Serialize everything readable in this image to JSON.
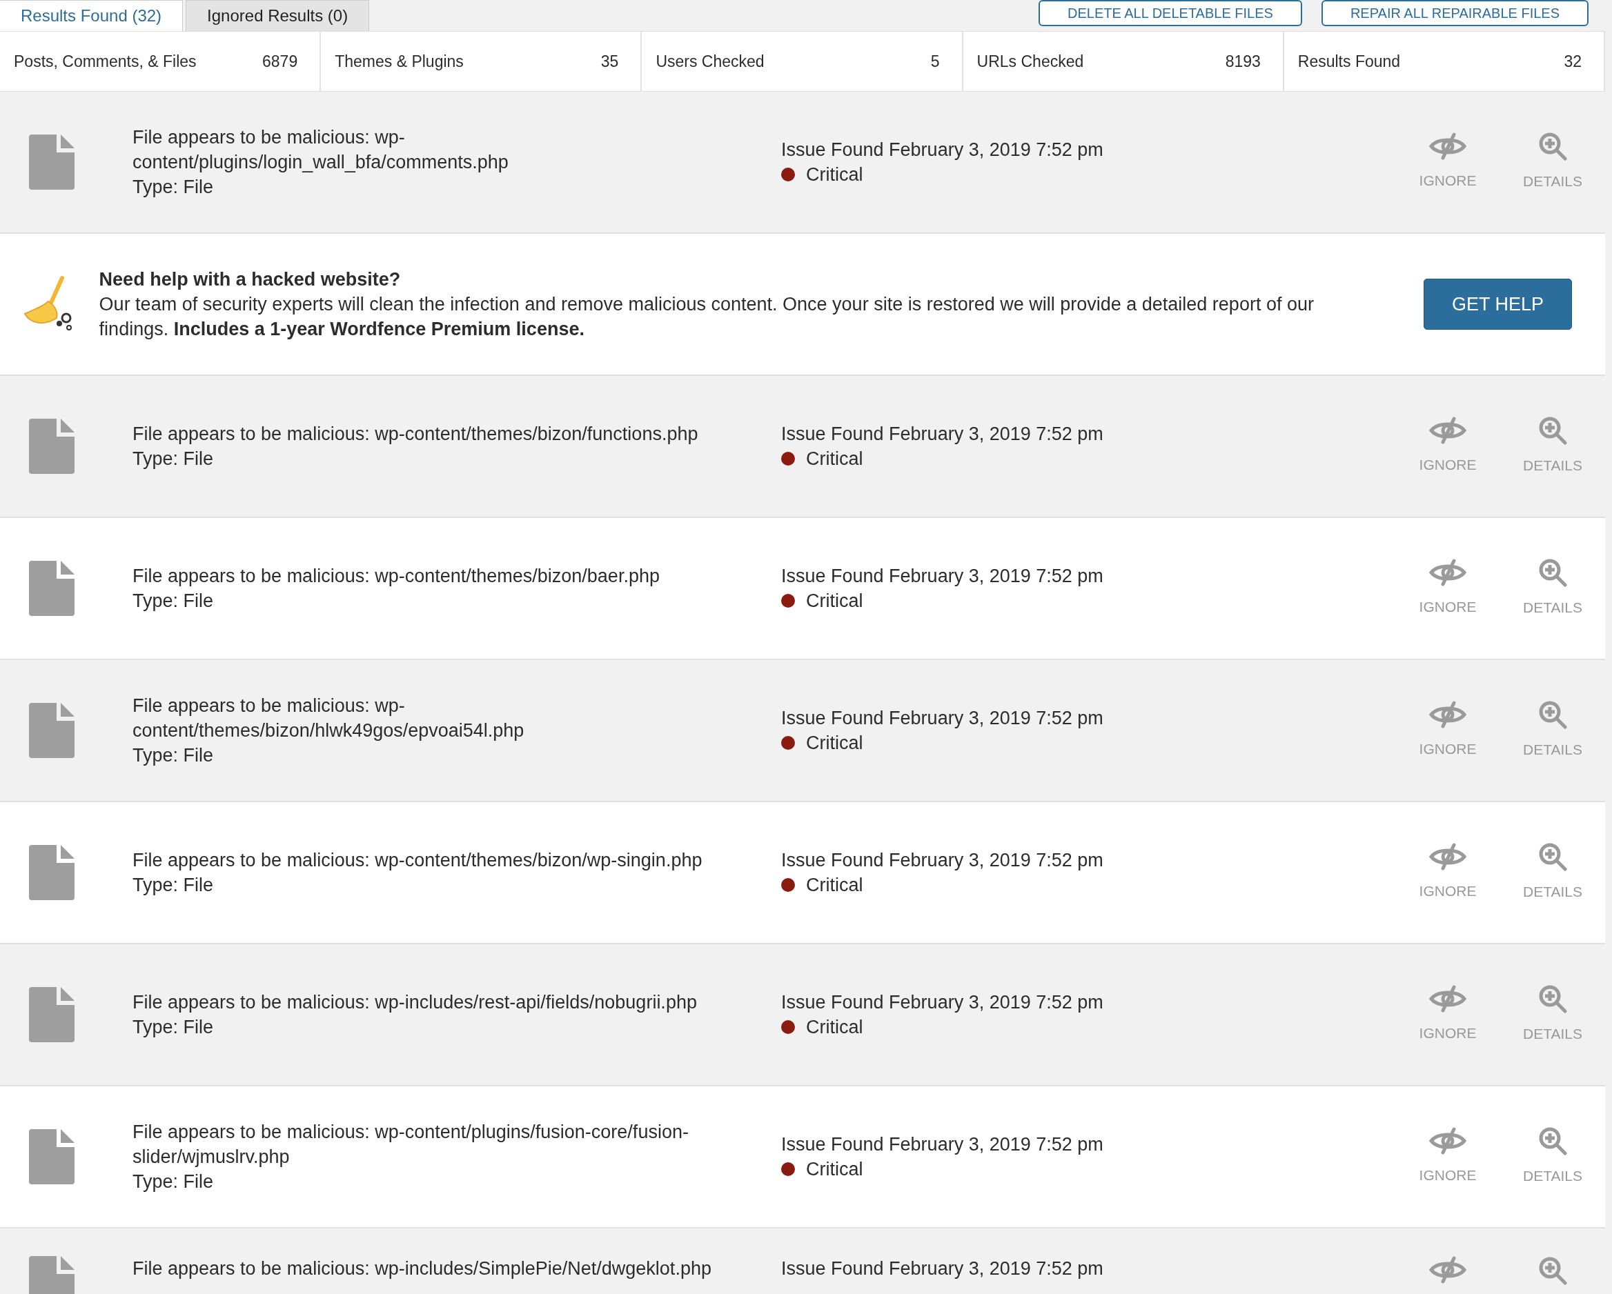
{
  "tabs": [
    {
      "label": "Results Found (32)",
      "selected": true
    },
    {
      "label": "Ignored Results (0)",
      "selected": false
    }
  ],
  "actions": [
    "DELETE ALL DELETABLE FILES",
    "REPAIR ALL REPAIRABLE FILES"
  ],
  "stats": [
    {
      "label": "Posts, Comments, & Files",
      "value": "6879"
    },
    {
      "label": "Themes & Plugins",
      "value": "35"
    },
    {
      "label": "Users Checked",
      "value": "5"
    },
    {
      "label": "URLs Checked",
      "value": "8193"
    },
    {
      "label": "Results Found",
      "value": "32"
    }
  ],
  "results": [
    {
      "kind": "issue",
      "description": "File appears to be malicious: wp-content/plugins/login_wall_bfa/comments.php",
      "type": "Type: File",
      "found": "Issue Found February 3, 2019 7:52 pm",
      "severity": "Critical",
      "ignore_label": "IGNORE",
      "details_label": "DETAILS"
    },
    {
      "kind": "promo",
      "title": "Need help with a hacked website?",
      "body": "Our team of security experts will clean the infection and remove malicious content. Once your site is restored we will provide a detailed report of our findings. **Includes a 1-year Wordfence Premium license.**",
      "button": "GET HELP"
    },
    {
      "kind": "issue",
      "description": "File appears to be malicious: wp-content/themes/bizon/functions.php",
      "type": "Type: File",
      "found": "Issue Found February 3, 2019 7:52 pm",
      "severity": "Critical",
      "ignore_label": "IGNORE",
      "details_label": "DETAILS"
    },
    {
      "kind": "issue",
      "description": "File appears to be malicious: wp-content/themes/bizon/baer.php",
      "type": "Type: File",
      "found": "Issue Found February 3, 2019 7:52 pm",
      "severity": "Critical",
      "ignore_label": "IGNORE",
      "details_label": "DETAILS"
    },
    {
      "kind": "issue",
      "description": "File appears to be malicious: wp-content/themes/bizon/hlwk49gos/epvoai54l.php",
      "type": "Type: File",
      "found": "Issue Found February 3, 2019 7:52 pm",
      "severity": "Critical",
      "ignore_label": "IGNORE",
      "details_label": "DETAILS"
    },
    {
      "kind": "issue",
      "description": "File appears to be malicious: wp-content/themes/bizon/wp-singin.php",
      "type": "Type: File",
      "found": "Issue Found February 3, 2019 7:52 pm",
      "severity": "Critical",
      "ignore_label": "IGNORE",
      "details_label": "DETAILS"
    },
    {
      "kind": "issue",
      "description": "File appears to be malicious: wp-includes/rest-api/fields/nobugrii.php",
      "type": "Type: File",
      "found": "Issue Found February 3, 2019 7:52 pm",
      "severity": "Critical",
      "ignore_label": "IGNORE",
      "details_label": "DETAILS"
    },
    {
      "kind": "issue",
      "description": "File appears to be malicious: wp-content/plugins/fusion-core/fusion-slider/wjmuslrv.php",
      "type": "Type: File",
      "found": "Issue Found February 3, 2019 7:52 pm",
      "severity": "Critical",
      "ignore_label": "IGNORE",
      "details_label": "DETAILS"
    },
    {
      "kind": "issue",
      "description": "File appears to be malicious: wp-includes/SimplePie/Net/dwgeklot.php",
      "found": "Issue Found February 3, 2019 7:52 pm"
    }
  ]
}
